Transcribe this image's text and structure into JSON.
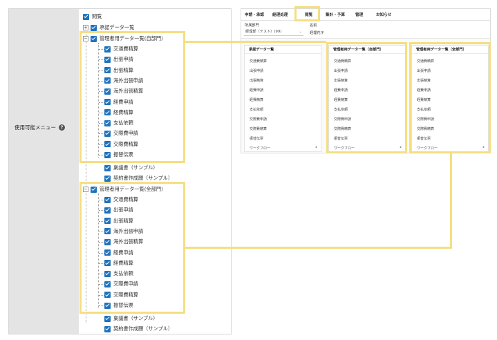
{
  "settings": {
    "menu_label": "使用可能メニュー",
    "help_icon": "help-icon",
    "tree": {
      "root": "閲覧",
      "approval_list": "承認データ一覧",
      "admin_dept": {
        "label": "管理者用データ一覧(自部門)",
        "children": [
          "交通費精算",
          "出張申請",
          "出張精算",
          "海外出張申請",
          "海外出張精算",
          "経費申請",
          "経費精算",
          "支払依頼",
          "交際費申請",
          "交際費精算",
          "振替伝票"
        ]
      },
      "ringi_sample": "稟議書（サンプル）",
      "contract_sample": "契約書作成願（サンプル）",
      "admin_all": {
        "label": "管理者用データ一覧(全部門)",
        "children": [
          "交通費精算",
          "出張申請",
          "出張精算",
          "海外出張申請",
          "海外出張精算",
          "経費申請",
          "経費精算",
          "支払依頼",
          "交際費申請",
          "交際費精算",
          "振替伝票"
        ]
      },
      "ringi_sample_2": "稟議書（サンプル）",
      "contract_sample_2": "契約書作成願（サンプル）"
    }
  },
  "app": {
    "nav": [
      "申請・承認",
      "経理処理",
      "閲覧",
      "集計・予算",
      "管理",
      "お知らせ"
    ],
    "active_nav": "閲覧",
    "dept_label": "所属部門",
    "dept_value": "経理部（テスト）(99)",
    "name_label": "名前",
    "name_value": "経理花子",
    "cards": [
      {
        "title": "承認データ一覧",
        "items": [
          "交通費精算",
          "出張申請",
          "出張精算",
          "経費申請",
          "経費精算",
          "支払依頼",
          "交際費申請",
          "交際費精算",
          "振替伝票"
        ],
        "footer": "ワークフロー"
      },
      {
        "title": "管理者用データ一覧（自部門）",
        "items": [
          "交通費精算",
          "出張申請",
          "出張精算",
          "経費申請",
          "経費精算",
          "支払依頼",
          "交際費申請",
          "交際費精算",
          "振替伝票"
        ],
        "footer": "ワークフロー"
      },
      {
        "title": "管理者用データ一覧（全部門）",
        "items": [
          "交通費精算",
          "出張申請",
          "出張精算",
          "経費申請",
          "経費精算",
          "支払依頼",
          "交際費申請",
          "交際費精算",
          "振替伝票"
        ],
        "footer": "ワークフロー"
      }
    ]
  },
  "colors": {
    "highlight": "#f5de82",
    "checkbox": "#1e73be",
    "label_column": "#e4e4e4"
  }
}
